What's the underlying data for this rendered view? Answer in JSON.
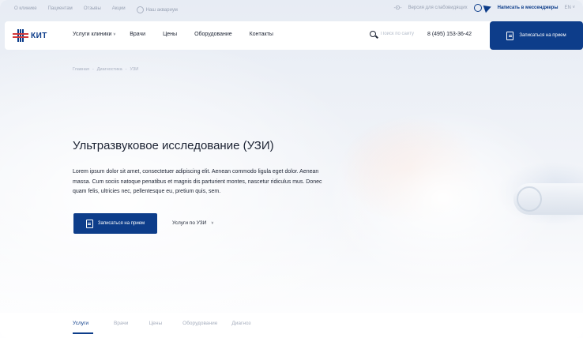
{
  "topbar": {
    "links": [
      "О клинике",
      "Пациентам",
      "Отзывы",
      "Акции"
    ],
    "aquarium": "Наш аквариум",
    "accessibility": "Версия для слабовидящих",
    "messengers": "Написать в мессенджеры",
    "lang": "EN"
  },
  "header": {
    "logo_text": "КИТ",
    "nav": [
      "Услуги клиники",
      "Врачи",
      "Цены",
      "Оборудование",
      "Контакты"
    ],
    "search_placeholder": "Поиск по сайту",
    "phone": "8 (495) 153-36-42",
    "cta": "Записаться на прием"
  },
  "breadcrumb": [
    "Главная",
    "Диагностика",
    "УЗИ"
  ],
  "hero": {
    "title": "Ультразвуковое исследование (УЗИ)",
    "intro": "Lorem ipsum dolor sit amet, consectetuer adipiscing elit. Aenean commodo ligula eget dolor. Aenean massa. Cum sociis natoque penatibus et magnis dis parturient montes, nascetur ridiculus mus. Donec quam felis, ultricies nec, pellentesque eu, pretium quis, sem.",
    "cta": "Записаться на прием",
    "services_dropdown": "Услуги по УЗИ"
  },
  "tabs": [
    "Услуги",
    "Врачи",
    "Цены",
    "Оборудование",
    "Диагноз"
  ],
  "colors": {
    "brand": "#0d3d8a",
    "accent": "#d23a3a"
  }
}
